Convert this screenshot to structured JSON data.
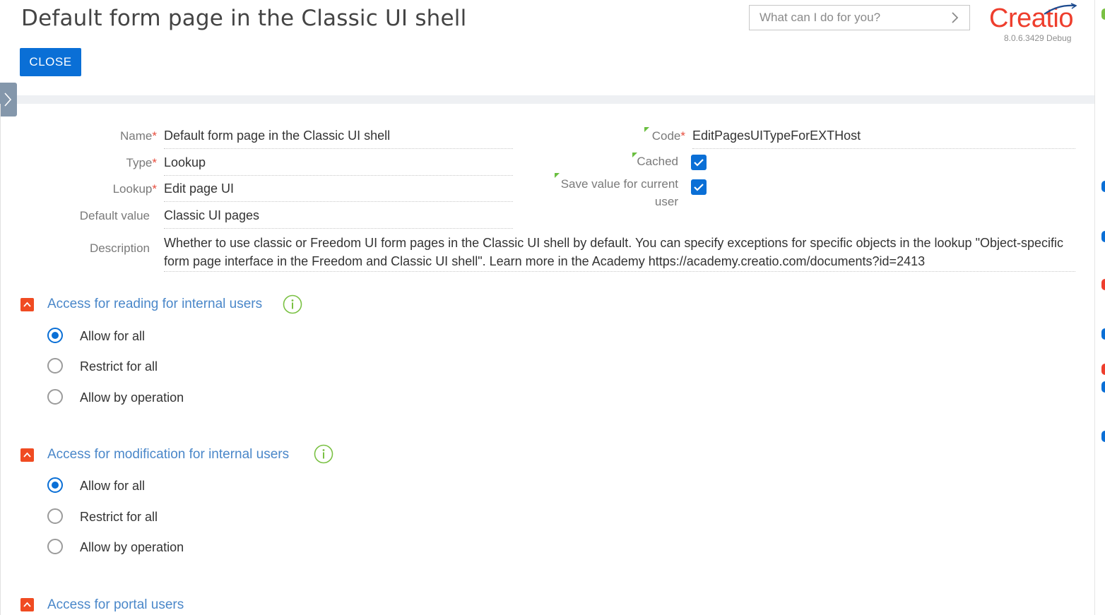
{
  "header": {
    "title": "Default form page in the Classic UI shell",
    "close_label": "CLOSE",
    "search_placeholder": "What can I do for you?",
    "logo_text": "Creatio",
    "version": "8.0.6.3429 Debug"
  },
  "form": {
    "name": {
      "label": "Name",
      "value": "Default form page in the Classic UI shell",
      "required": true
    },
    "type": {
      "label": "Type",
      "value": "Lookup",
      "required": true
    },
    "lookup": {
      "label": "Lookup",
      "value": "Edit page UI",
      "required": true
    },
    "default_value": {
      "label": "Default value",
      "value": "Classic UI pages"
    },
    "description": {
      "label": "Description",
      "value": "Whether to use classic or Freedom UI form pages in the Classic UI shell by default. You can specify exceptions for specific objects in the lookup \"Object-specific form page interface in the Freedom and Classic UI shell\". Learn more in the Academy https://academy.creatio.com/documents?id=2413"
    },
    "code": {
      "label": "Code",
      "value": "EditPagesUITypeForEXTHost",
      "required": true
    },
    "cached": {
      "label": "Cached",
      "checked": true
    },
    "save_for_user": {
      "label_line1": "Save value for current",
      "label_line2": "user",
      "checked": true
    }
  },
  "sections": [
    {
      "title": "Access for reading for internal users",
      "options": [
        {
          "label": "Allow for all",
          "selected": true
        },
        {
          "label": "Restrict for all",
          "selected": false
        },
        {
          "label": "Allow by operation",
          "selected": false
        }
      ]
    },
    {
      "title": "Access for modification for internal users",
      "options": [
        {
          "label": "Allow for all",
          "selected": true
        },
        {
          "label": "Restrict for all",
          "selected": false
        },
        {
          "label": "Allow by operation",
          "selected": false
        }
      ]
    },
    {
      "title": "Access for portal users"
    }
  ],
  "colors": {
    "primary": "#0a6fd6",
    "brand": "#ee3e2d",
    "section_title": "#4a87c9",
    "section_toggle": "#f04b22",
    "info": "#7ac143"
  },
  "icons": [
    "chevron-right-icon",
    "collapse-arrow-icon",
    "info-icon",
    "checkmark-icon",
    "creatio-logo-icon"
  ]
}
